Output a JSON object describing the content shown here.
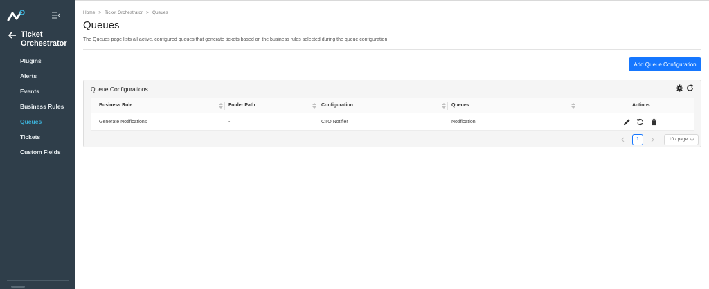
{
  "sidebar": {
    "back_title": "Ticket Orchestrator",
    "items": [
      {
        "label": "Plugins",
        "active": false
      },
      {
        "label": "Alerts",
        "active": false
      },
      {
        "label": "Events",
        "active": false
      },
      {
        "label": "Business Rules",
        "active": false
      },
      {
        "label": "Queues",
        "active": true
      },
      {
        "label": "Tickets",
        "active": false
      },
      {
        "label": "Custom Fields",
        "active": false
      }
    ],
    "accent_color": "#3cb4dc",
    "bg_color": "#2f3e4a"
  },
  "breadcrumb": [
    "Home",
    "Ticket Orchestrator",
    "Queues"
  ],
  "breadcrumb_separator": ">",
  "page": {
    "title": "Queues",
    "description": "The Queues page lists all active, configured queues that generate tickets based on the business rules selected during the queue configuration."
  },
  "toolbar": {
    "add_label": "Add Queue Configuration",
    "primary_color": "#1677ff"
  },
  "card": {
    "title": "Queue Configurations",
    "icons": [
      "gear-icon",
      "refresh-icon"
    ]
  },
  "table": {
    "columns": [
      "Business Rule",
      "Folder Path",
      "Configuration",
      "Queues",
      "Actions"
    ],
    "rows": [
      {
        "business_rule": "Generate Notifications",
        "folder_path": "-",
        "configuration": "CTO Notifier",
        "queues": "Notification",
        "actions": [
          "edit-icon",
          "sync-icon",
          "delete-icon"
        ]
      }
    ]
  },
  "pagination": {
    "current_page": "1",
    "page_size": "10 / page"
  }
}
